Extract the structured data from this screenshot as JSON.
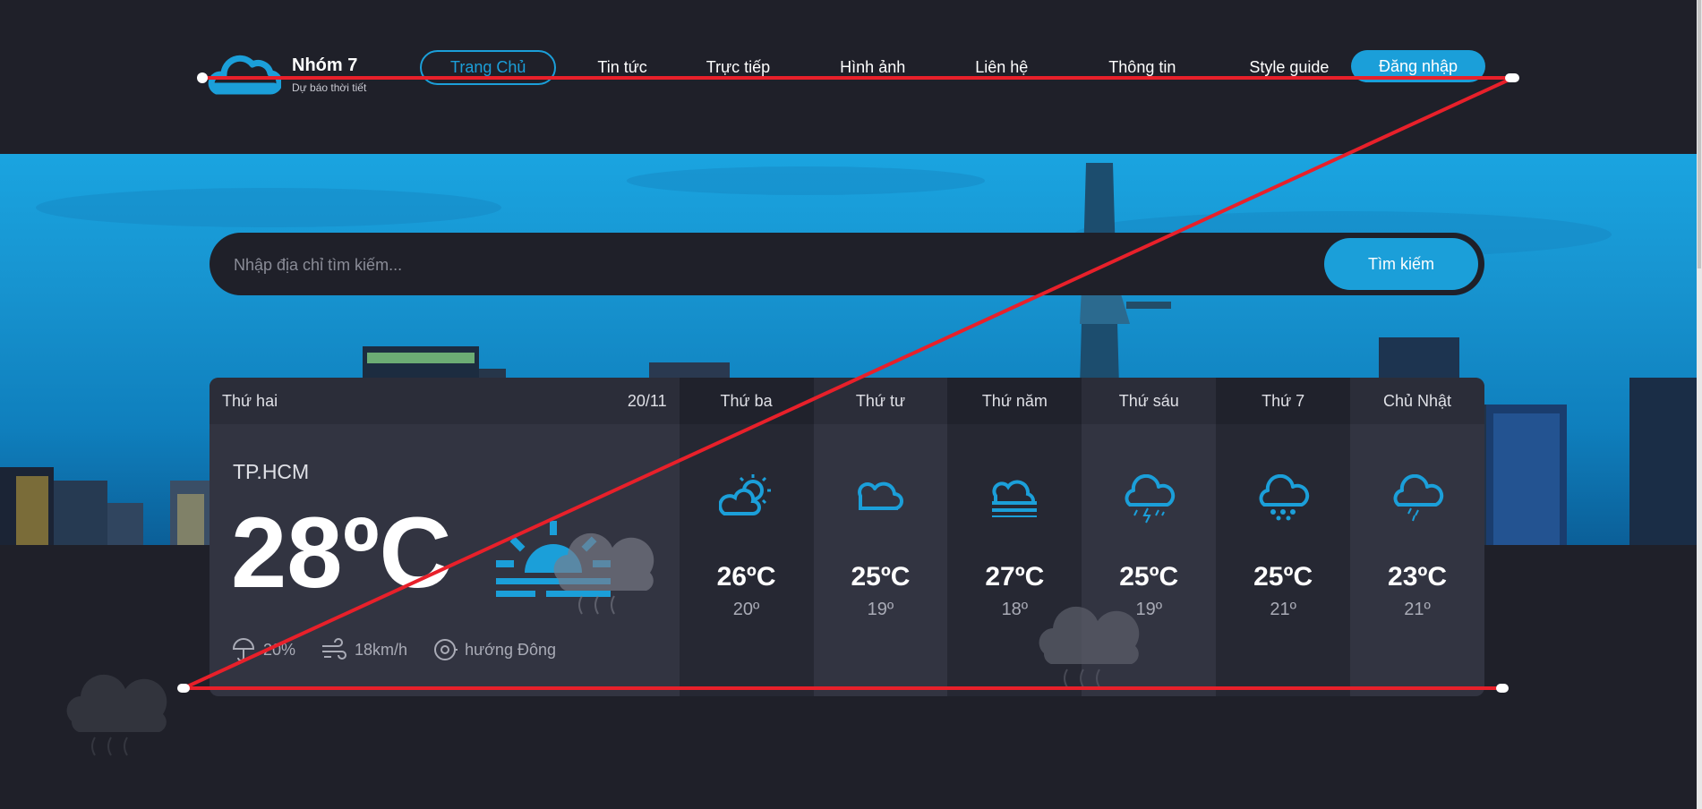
{
  "brand": {
    "name": "Nhóm 7",
    "subtitle": "Dự báo thời tiết",
    "logo_icon": "cloud-logo-icon",
    "accent": "#1b9fd9"
  },
  "nav": {
    "items": [
      "Trang Chủ",
      "Tin tức",
      "Trực tiếp",
      "Hình ảnh",
      "Liên hệ",
      "Thông tin",
      "Style guide"
    ],
    "active": "Trang Chủ",
    "login_label": "Đăng nhập"
  },
  "search": {
    "placeholder": "Nhập địa chỉ tìm kiếm...",
    "button_label": "Tìm kiếm"
  },
  "today": {
    "day": "Thứ hai",
    "date": "20/11",
    "city": "TP.HCM",
    "temperature": "28ºC",
    "icon": "sunrise-icon",
    "rain": "20%",
    "wind": "18km/h",
    "direction": "hướng Đông"
  },
  "forecast": [
    {
      "day": "Thứ ba",
      "max": "26ºC",
      "min": "20º",
      "icon": "partly-cloudy-icon"
    },
    {
      "day": "Thứ tư",
      "max": "25ºC",
      "min": "19º",
      "icon": "cloud-icon"
    },
    {
      "day": "Thứ năm",
      "max": "27ºC",
      "min": "18º",
      "icon": "fog-icon"
    },
    {
      "day": "Thứ sáu",
      "max": "25ºC",
      "min": "19º",
      "icon": "thunderstorm-icon"
    },
    {
      "day": "Thứ 7",
      "max": "25ºC",
      "min": "21º",
      "icon": "snow-icon"
    },
    {
      "day": "Chủ Nhật",
      "max": "23ºC",
      "min": "21º",
      "icon": "rain-icon"
    }
  ]
}
